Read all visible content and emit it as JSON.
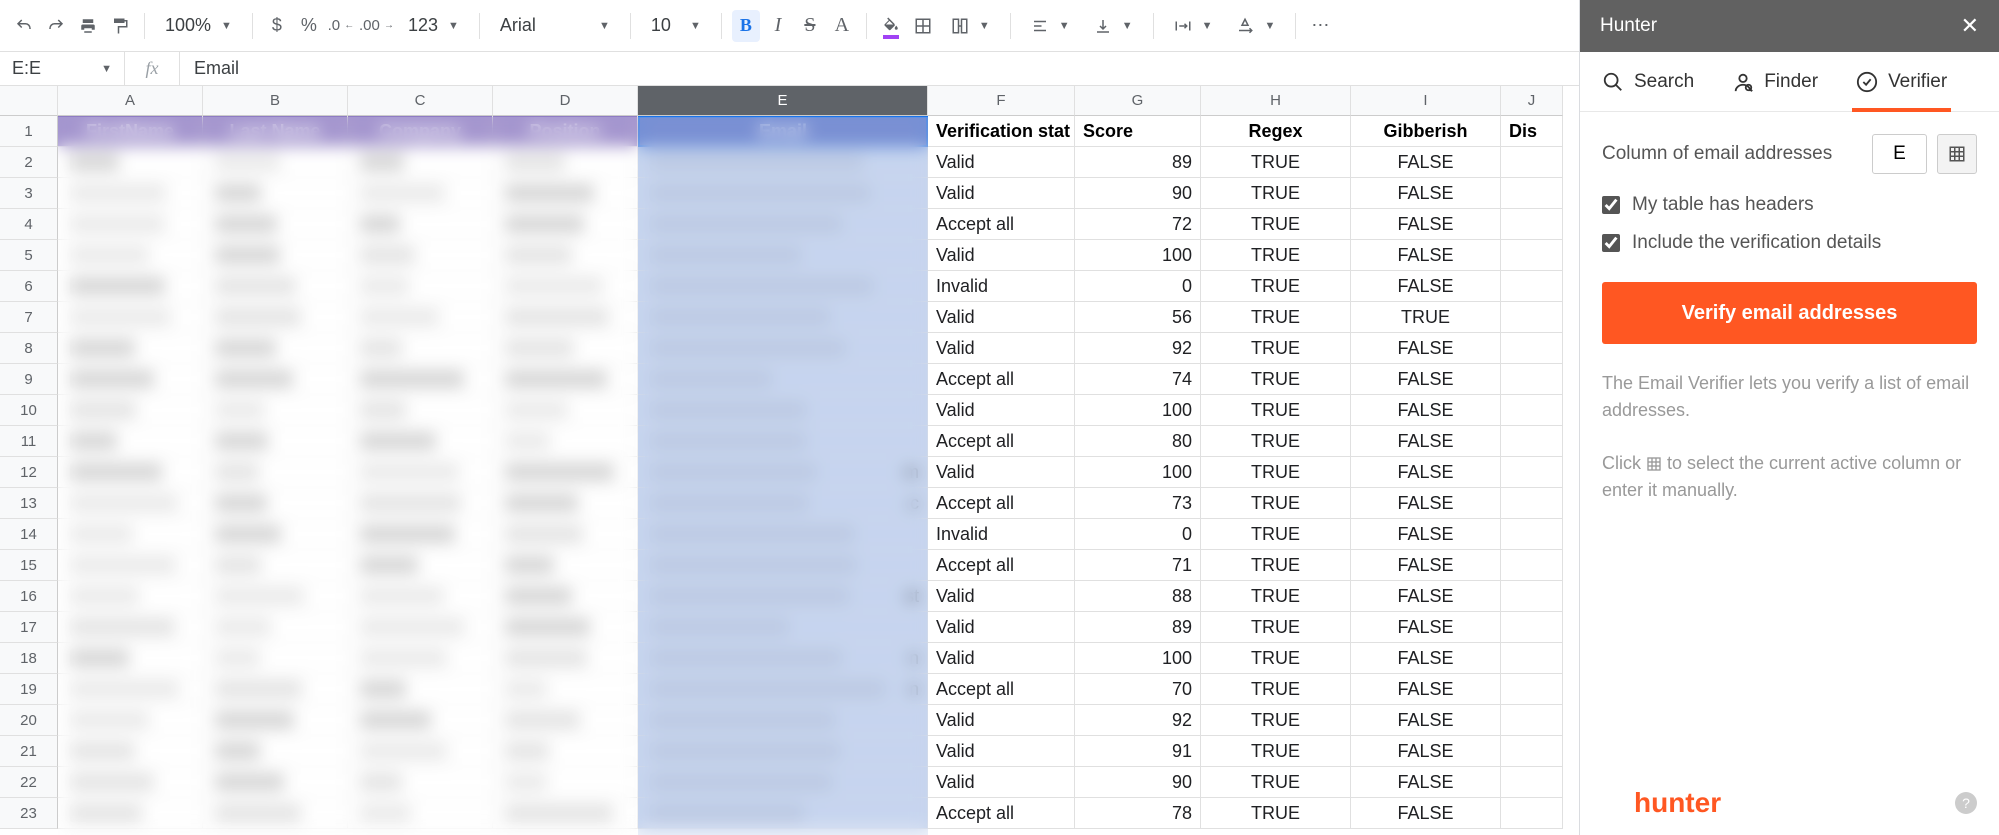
{
  "toolbar": {
    "zoom": "100%",
    "font": "Arial",
    "font_size": "10",
    "decimals_label": "123"
  },
  "formula_bar": {
    "name_box": "E:E",
    "formula": "Email"
  },
  "columns": [
    "A",
    "B",
    "C",
    "D",
    "E",
    "F",
    "G",
    "H",
    "I",
    "J"
  ],
  "headers": {
    "A": "FirstName",
    "B": "Last Name",
    "C": "Company",
    "D": "Position",
    "E": "Email",
    "F": "Verification stat",
    "G": "Score",
    "H": "Regex",
    "I": "Gibberish",
    "J": "Dis"
  },
  "row_count": 23,
  "data_rows": [
    {
      "F": "Valid",
      "G": 89,
      "H": "TRUE",
      "I": "FALSE"
    },
    {
      "F": "Valid",
      "G": 90,
      "H": "TRUE",
      "I": "FALSE"
    },
    {
      "F": "Accept all",
      "G": 72,
      "H": "TRUE",
      "I": "FALSE"
    },
    {
      "F": "Valid",
      "G": 100,
      "H": "TRUE",
      "I": "FALSE"
    },
    {
      "F": "Invalid",
      "G": 0,
      "H": "TRUE",
      "I": "FALSE"
    },
    {
      "F": "Valid",
      "G": 56,
      "H": "TRUE",
      "I": "TRUE"
    },
    {
      "F": "Valid",
      "G": 92,
      "H": "TRUE",
      "I": "FALSE"
    },
    {
      "F": "Accept all",
      "G": 74,
      "H": "TRUE",
      "I": "FALSE"
    },
    {
      "F": "Valid",
      "G": 100,
      "H": "TRUE",
      "I": "FALSE"
    },
    {
      "F": "Accept all",
      "G": 80,
      "H": "TRUE",
      "I": "FALSE"
    },
    {
      "F": "Valid",
      "G": 100,
      "H": "TRUE",
      "I": "FALSE",
      "E_tail": "m"
    },
    {
      "F": "Accept all",
      "G": 73,
      "H": "TRUE",
      "I": "FALSE",
      "E_tail": ".c"
    },
    {
      "F": "Invalid",
      "G": 0,
      "H": "TRUE",
      "I": "FALSE"
    },
    {
      "F": "Accept all",
      "G": 71,
      "H": "TRUE",
      "I": "FALSE"
    },
    {
      "F": "Valid",
      "G": 88,
      "H": "TRUE",
      "I": "FALSE",
      "E_tail": "st"
    },
    {
      "F": "Valid",
      "G": 89,
      "H": "TRUE",
      "I": "FALSE"
    },
    {
      "F": "Valid",
      "G": 100,
      "H": "TRUE",
      "I": "FALSE",
      "E_tail": "n"
    },
    {
      "F": "Accept all",
      "G": 70,
      "H": "TRUE",
      "I": "FALSE",
      "E_tail": "n"
    },
    {
      "F": "Valid",
      "G": 92,
      "H": "TRUE",
      "I": "FALSE"
    },
    {
      "F": "Valid",
      "G": 91,
      "H": "TRUE",
      "I": "FALSE"
    },
    {
      "F": "Valid",
      "G": 90,
      "H": "TRUE",
      "I": "FALSE"
    },
    {
      "F": "Accept all",
      "G": 78,
      "H": "TRUE",
      "I": "FALSE"
    }
  ],
  "hunter": {
    "title": "Hunter",
    "tabs": {
      "search": "Search",
      "finder": "Finder",
      "verifier": "Verifier"
    },
    "active_tab": "verifier",
    "column_label": "Column of email addresses",
    "column_value": "E",
    "check_headers": "My table has headers",
    "check_details": "Include the verification details",
    "verify_button": "Verify email addresses",
    "help1": "The Email Verifier lets you verify a list of email addresses.",
    "help2a": "Click ",
    "help2b": " to select the current active column or enter it manually.",
    "logo": "hunter"
  }
}
